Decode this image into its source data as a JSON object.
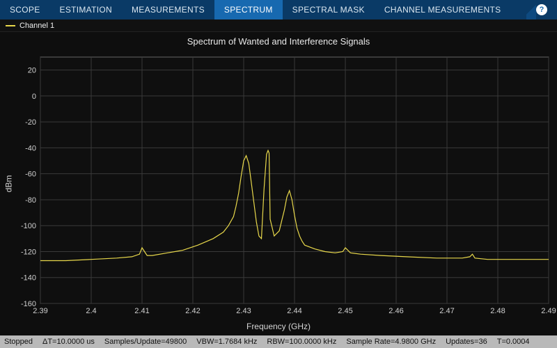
{
  "toolbar": {
    "tabs": [
      "SCOPE",
      "ESTIMATION",
      "MEASUREMENTS",
      "SPECTRUM",
      "SPECTRAL MASK",
      "CHANNEL MEASUREMENTS"
    ],
    "active_index": 3,
    "help_tooltip": "?"
  },
  "legend": {
    "items": [
      {
        "name": "Channel 1",
        "color": "#e8d84b"
      }
    ]
  },
  "chart_data": {
    "type": "line",
    "title": "Spectrum of Wanted and Interference Signals",
    "xlabel": "Frequency (GHz)",
    "ylabel": "dBm",
    "xlim": [
      2.39,
      2.49
    ],
    "ylim": [
      -160,
      30
    ],
    "xticks": [
      2.39,
      2.4,
      2.41,
      2.42,
      2.43,
      2.44,
      2.45,
      2.46,
      2.47,
      2.48,
      2.49
    ],
    "yticks": [
      -160,
      -140,
      -120,
      -100,
      -80,
      -60,
      -40,
      -20,
      0,
      20
    ],
    "series": [
      {
        "name": "Channel 1",
        "color": "#e8d84b",
        "x": [
          2.39,
          2.395,
          2.4,
          2.405,
          2.408,
          2.4095,
          2.41,
          2.4105,
          2.411,
          2.412,
          2.415,
          2.418,
          2.421,
          2.424,
          2.426,
          2.427,
          2.428,
          2.4285,
          2.429,
          2.4295,
          2.43,
          2.4305,
          2.431,
          2.4315,
          2.432,
          2.4325,
          2.433,
          2.4335,
          2.434,
          2.4345,
          2.4348,
          2.435,
          2.4352,
          2.436,
          2.437,
          2.4375,
          2.438,
          2.4385,
          2.439,
          2.4395,
          2.44,
          2.4405,
          2.441,
          2.4415,
          2.442,
          2.444,
          2.446,
          2.448,
          2.4495,
          2.45,
          2.4505,
          2.451,
          2.453,
          2.457,
          2.462,
          2.468,
          2.473,
          2.4745,
          2.475,
          2.4755,
          2.478,
          2.484,
          2.49
        ],
        "y": [
          -127,
          -127,
          -126,
          -125,
          -124,
          -122,
          -117,
          -120,
          -123,
          -123,
          -121,
          -119,
          -115,
          -110,
          -105,
          -100,
          -93,
          -85,
          -75,
          -62,
          -50,
          -46,
          -52,
          -67,
          -82,
          -97,
          -108,
          -110,
          -72,
          -45,
          -42,
          -44,
          -95,
          -108,
          -104,
          -96,
          -88,
          -78,
          -73,
          -80,
          -92,
          -102,
          -108,
          -112,
          -115,
          -118,
          -120,
          -121,
          -120,
          -117,
          -119,
          -121,
          -122,
          -123,
          -124,
          -125,
          -125,
          -124,
          -122,
          -125,
          -126,
          -126,
          -126
        ]
      }
    ]
  },
  "status": {
    "state": "Stopped",
    "delta_t": "ΔT=10.0000 us",
    "samples_per_update": "Samples/Update=49800",
    "vbw": "VBW=1.7684 kHz",
    "rbw": "RBW=100.0000 kHz",
    "sample_rate": "Sample Rate=4.9800 GHz",
    "updates": "Updates=36",
    "t": "T=0.0004"
  }
}
